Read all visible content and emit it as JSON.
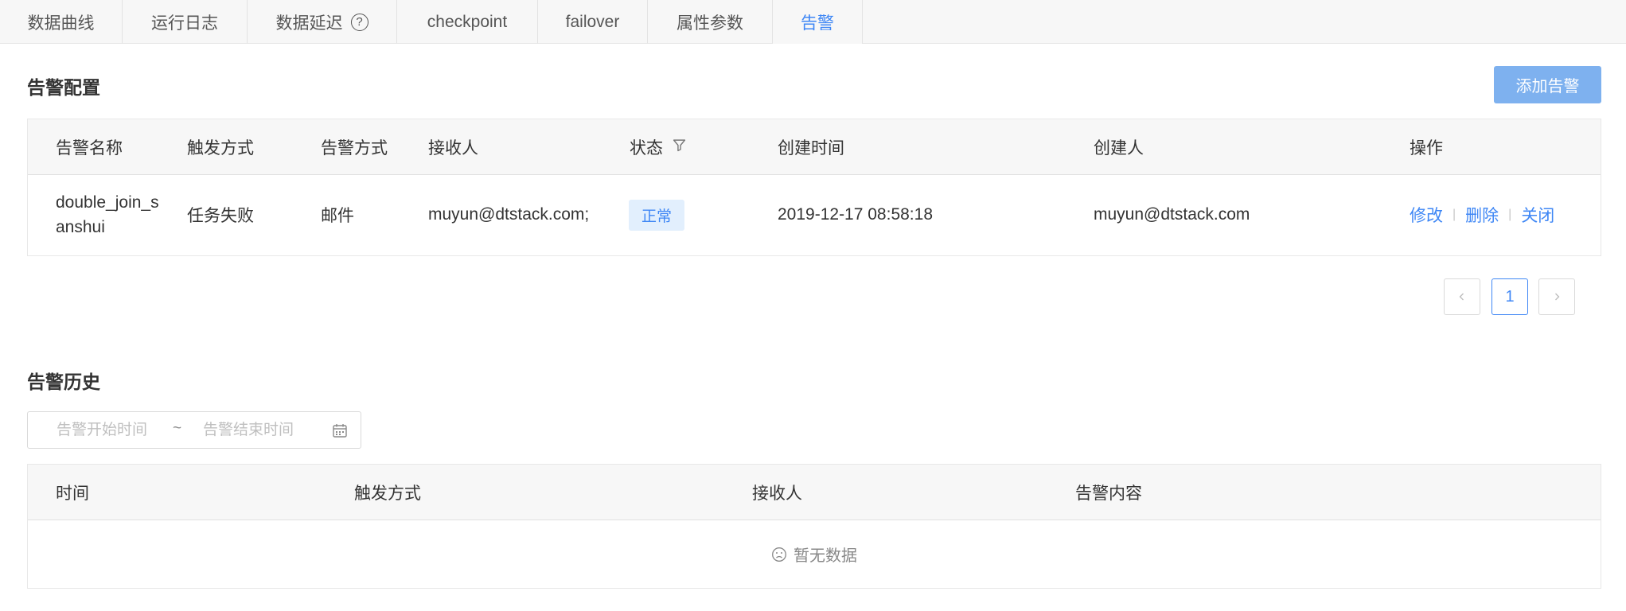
{
  "tabs": [
    {
      "label": "数据曲线"
    },
    {
      "label": "运行日志"
    },
    {
      "label": "数据延迟"
    },
    {
      "label": "checkpoint"
    },
    {
      "label": "failover"
    },
    {
      "label": "属性参数"
    },
    {
      "label": "告警"
    }
  ],
  "active_tab": "告警",
  "alert_config": {
    "title": "告警配置",
    "add_button": "添加告警",
    "columns": [
      "告警名称",
      "触发方式",
      "告警方式",
      "接收人",
      "状态",
      "创建时间",
      "创建人",
      "操作"
    ],
    "rows": [
      {
        "name_line1": "double_join_s",
        "name_line2": "anshui",
        "trigger": "任务失败",
        "method": "邮件",
        "receiver": "muyun@dtstack.com;",
        "status": "正常",
        "created_time": "2019-12-17 08:58:18",
        "creator": "muyun@dtstack.com",
        "actions": [
          "修改",
          "删除",
          "关闭"
        ]
      }
    ],
    "pagination": {
      "current": "1",
      "prev": "<",
      "next": ">"
    }
  },
  "alert_history": {
    "title": "告警历史",
    "date_start_placeholder": "告警开始时间",
    "date_separator": "~",
    "date_end_placeholder": "告警结束时间",
    "columns": [
      "时间",
      "触发方式",
      "接收人",
      "告警内容"
    ],
    "empty_text": "暂无数据"
  },
  "colors": {
    "accent": "#3f87f5",
    "button": "#7eb1ef",
    "badge_bg": "#e2effd"
  }
}
